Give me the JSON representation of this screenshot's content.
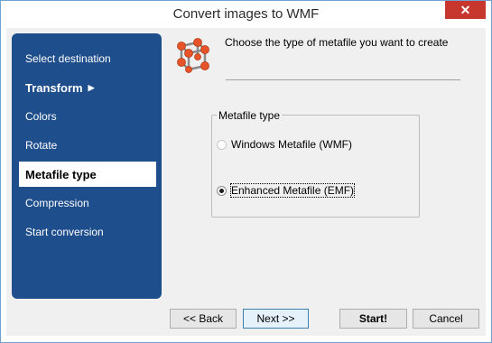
{
  "window": {
    "title": "Convert images to WMF",
    "close_glyph": "✕"
  },
  "sidebar": {
    "items": [
      {
        "label": "Select destination"
      },
      {
        "label": "Transform",
        "arrow": "▶"
      },
      {
        "label": "Colors"
      },
      {
        "label": "Rotate"
      },
      {
        "label": "Metafile type"
      },
      {
        "label": "Compression"
      },
      {
        "label": "Start conversion"
      }
    ]
  },
  "header": {
    "text": "Choose the type of metafile you want to create",
    "icon": "molecule-icon"
  },
  "metafile_group": {
    "legend": "Metafile type",
    "options": [
      {
        "label": "Windows Metafile  (WMF)",
        "checked": false
      },
      {
        "label": "Enhanced Metafile (EMF)",
        "checked": true
      }
    ]
  },
  "buttons": {
    "back": "<< Back",
    "next": "Next >>",
    "start": "Start!",
    "cancel": "Cancel"
  },
  "colors": {
    "sidebar_bg": "#1f4e8c",
    "close_bg": "#c7372e",
    "molecule_orange": "#e8542a"
  }
}
